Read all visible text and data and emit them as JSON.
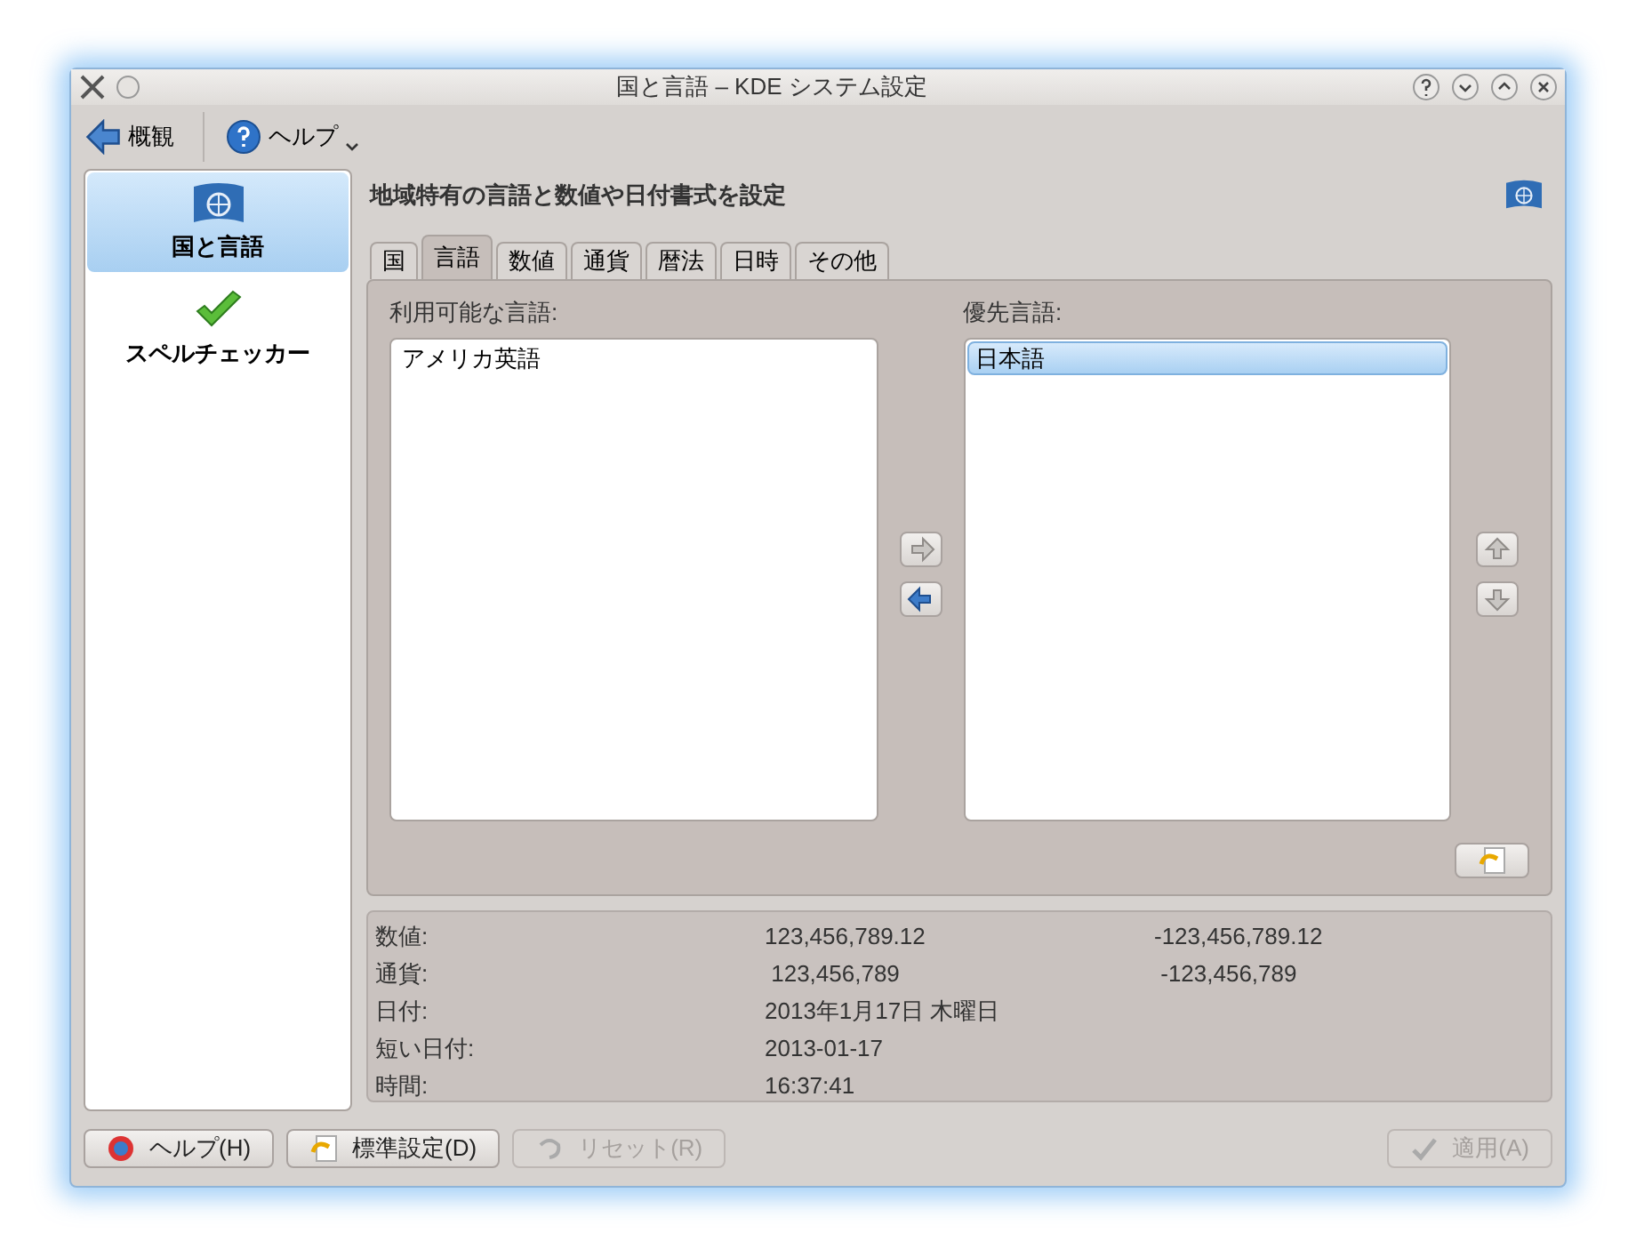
{
  "window": {
    "title": "国と言語 – KDE システム設定"
  },
  "toolbar": {
    "back": "概観",
    "help": "ヘルプ"
  },
  "sidebar": {
    "items": [
      {
        "label": "国と言語",
        "kind": "flag",
        "selected": true
      },
      {
        "label": "スペルチェッカー",
        "kind": "spell",
        "selected": false
      }
    ]
  },
  "heading": "地域特有の言語と数値や日付書式を設定",
  "tabs": [
    {
      "label": "国",
      "selected": false
    },
    {
      "label": "言語",
      "selected": true
    },
    {
      "label": "数値",
      "selected": false
    },
    {
      "label": "通貨",
      "selected": false
    },
    {
      "label": "暦法",
      "selected": false
    },
    {
      "label": "日時",
      "selected": false
    },
    {
      "label": "その他",
      "selected": false
    }
  ],
  "available": {
    "label": "利用可能な言語:",
    "items": [
      {
        "label": "アメリカ英語",
        "selected": false
      }
    ]
  },
  "preferred": {
    "label": "優先言語:",
    "items": [
      {
        "label": "日本語",
        "selected": true
      }
    ]
  },
  "move_buttons": [
    {
      "kind": "right",
      "disabled": true
    },
    {
      "kind": "left",
      "disabled": false
    }
  ],
  "order_buttons": [
    {
      "kind": "up",
      "disabled": true
    },
    {
      "kind": "down",
      "disabled": true
    }
  ],
  "preview": [
    {
      "label": "数値:",
      "positive": "123,456,789.12",
      "negative": "-123,456,789.12"
    },
    {
      "label": "通貨:",
      "positive": " 123,456,789",
      "negative": " -123,456,789"
    },
    {
      "label": "日付:",
      "positive": "2013年1月17日 木曜日"
    },
    {
      "label": "短い日付:",
      "positive": "2013-01-17"
    },
    {
      "label": "時間:",
      "positive": "16:37:41"
    }
  ],
  "buttons": [
    {
      "label": "ヘルプ(H)",
      "kind": "help",
      "disabled": false
    },
    {
      "label": "標準設定(D)",
      "kind": "defaults",
      "disabled": false
    },
    {
      "label": "リセット(R)",
      "kind": "reset",
      "disabled": true
    },
    {
      "label": "適用(A)",
      "kind": "apply",
      "disabled": true
    }
  ]
}
